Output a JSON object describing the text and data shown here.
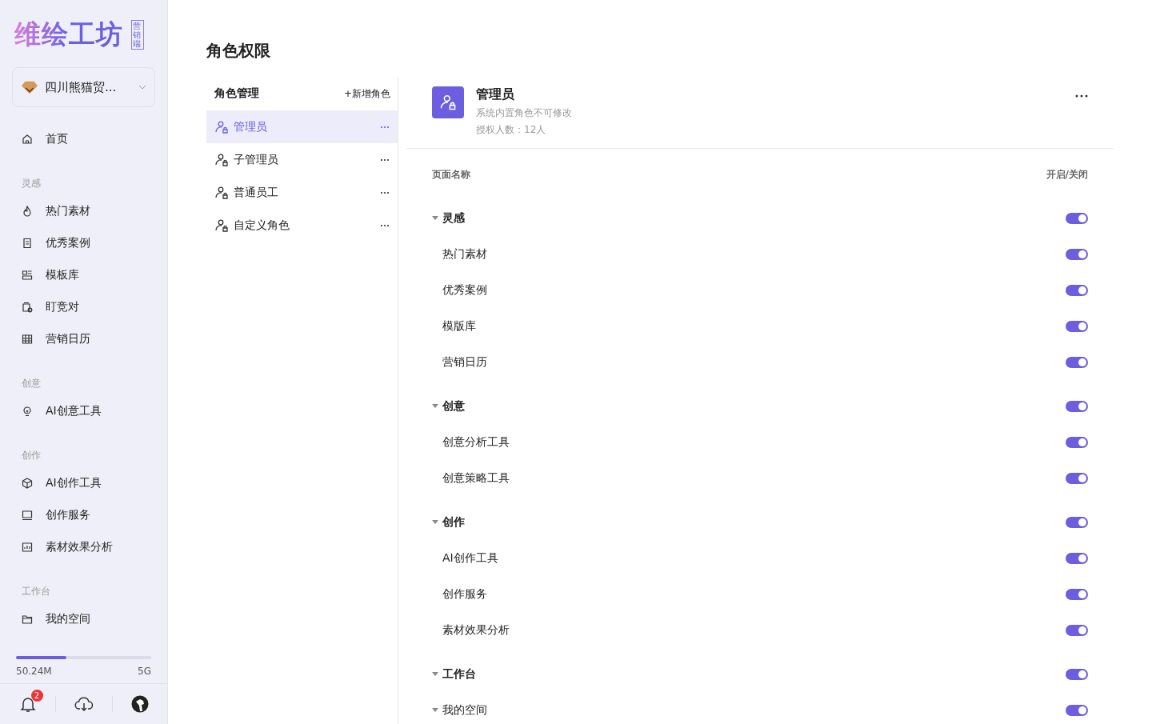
{
  "sidebar": {
    "logo": "维绘工坊",
    "logo_badge": "营销端",
    "org": "四川熊猫贸...",
    "nav": [
      {
        "items": [
          {
            "label": "首页"
          }
        ]
      },
      {
        "title": "灵感",
        "items": [
          {
            "label": "热门素材"
          },
          {
            "label": "优秀案例"
          },
          {
            "label": "模板库"
          },
          {
            "label": "盯竞对"
          },
          {
            "label": "营销日历"
          }
        ]
      },
      {
        "title": "创意",
        "items": [
          {
            "label": "AI创意工具"
          }
        ]
      },
      {
        "title": "创作",
        "items": [
          {
            "label": "AI创作工具"
          },
          {
            "label": "创作服务"
          },
          {
            "label": "素材效果分析"
          }
        ]
      },
      {
        "title": "工作台",
        "items": [
          {
            "label": "我的空间"
          }
        ]
      }
    ],
    "storage": {
      "used": "50.24M",
      "total": "5G",
      "level": 0.37
    },
    "notification_count": "2"
  },
  "page_title": "角色权限",
  "roles": {
    "title": "角色管理",
    "add": "+新增角色",
    "items": [
      {
        "name": "管理员",
        "selected": true
      },
      {
        "name": "子管理员",
        "selected": false
      },
      {
        "name": "普通员工",
        "selected": false
      },
      {
        "name": "自定义角色",
        "selected": false
      }
    ]
  },
  "detail": {
    "name": "管理员",
    "note": "系统内置角色不可修改",
    "count": "授权人数：12人",
    "columns": [
      "页面名称",
      "开启/关闭"
    ],
    "groups": [
      {
        "label": "灵感",
        "expanded": true,
        "on": true,
        "children": [
          {
            "label": "热门素材",
            "on": true
          },
          {
            "label": "优秀案例",
            "on": true
          },
          {
            "label": "模版库",
            "on": true
          },
          {
            "label": "营销日历",
            "on": true
          }
        ]
      },
      {
        "label": "创意",
        "expanded": true,
        "on": true,
        "children": [
          {
            "label": "创意分析工具",
            "on": true
          },
          {
            "label": "创意策略工具",
            "on": true
          }
        ]
      },
      {
        "label": "创作",
        "expanded": true,
        "on": true,
        "children": [
          {
            "label": "AI创作工具",
            "on": true
          },
          {
            "label": "创作服务",
            "on": true
          },
          {
            "label": "素材效果分析",
            "on": true
          }
        ]
      },
      {
        "label": "工作台",
        "expanded": true,
        "on": true,
        "children": [
          {
            "label": "我的空间",
            "expanded": true,
            "on": true
          }
        ]
      }
    ]
  }
}
